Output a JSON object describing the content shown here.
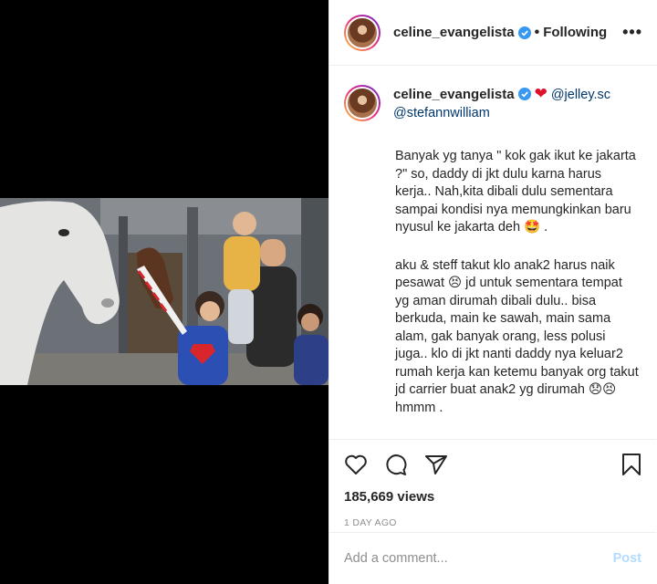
{
  "post": {
    "username": "celine_evangelista",
    "follow_status": "Following",
    "separator": "•",
    "more_label": "•••"
  },
  "caption": {
    "username": "celine_evangelista",
    "mention1": "@jelley.sc",
    "mention2": "@stefannwilliam",
    "paragraph1": "Banyak yg tanya \" kok gak ikut ke jakarta ?\" so, daddy di jkt dulu karna harus kerja.. Nah,kita dibali dulu sementara sampai kondisi nya memungkinkan baru nyusul ke jakarta deh 🤩 .",
    "paragraph2": "aku & steff takut klo anak2 harus naik pesawat 😣 jd untuk sementara tempat yg aman dirumah dibali dulu.. bisa berkuda, main ke sawah, main sama alam, gak banyak orang, less polusi juga.. klo di jkt nanti daddy nya keluar2 rumah kerja kan ketemu banyak org takut jd carrier buat anak2 yg dirumah 😞😣 hmmm ."
  },
  "stats": {
    "views": "185,669 views",
    "date": "1 DAY AGO"
  },
  "comment": {
    "placeholder": "Add a comment...",
    "post_label": "Post"
  },
  "icons": {
    "like": "heart-outline-icon",
    "comment": "speech-bubble-icon",
    "share": "paper-plane-icon",
    "save": "bookmark-icon",
    "verified": "verified-badge-icon"
  },
  "colors": {
    "verified": "#3897f0",
    "link": "#00376b",
    "post_disabled": "#b3dbff",
    "muted": "#8e8e8e"
  }
}
